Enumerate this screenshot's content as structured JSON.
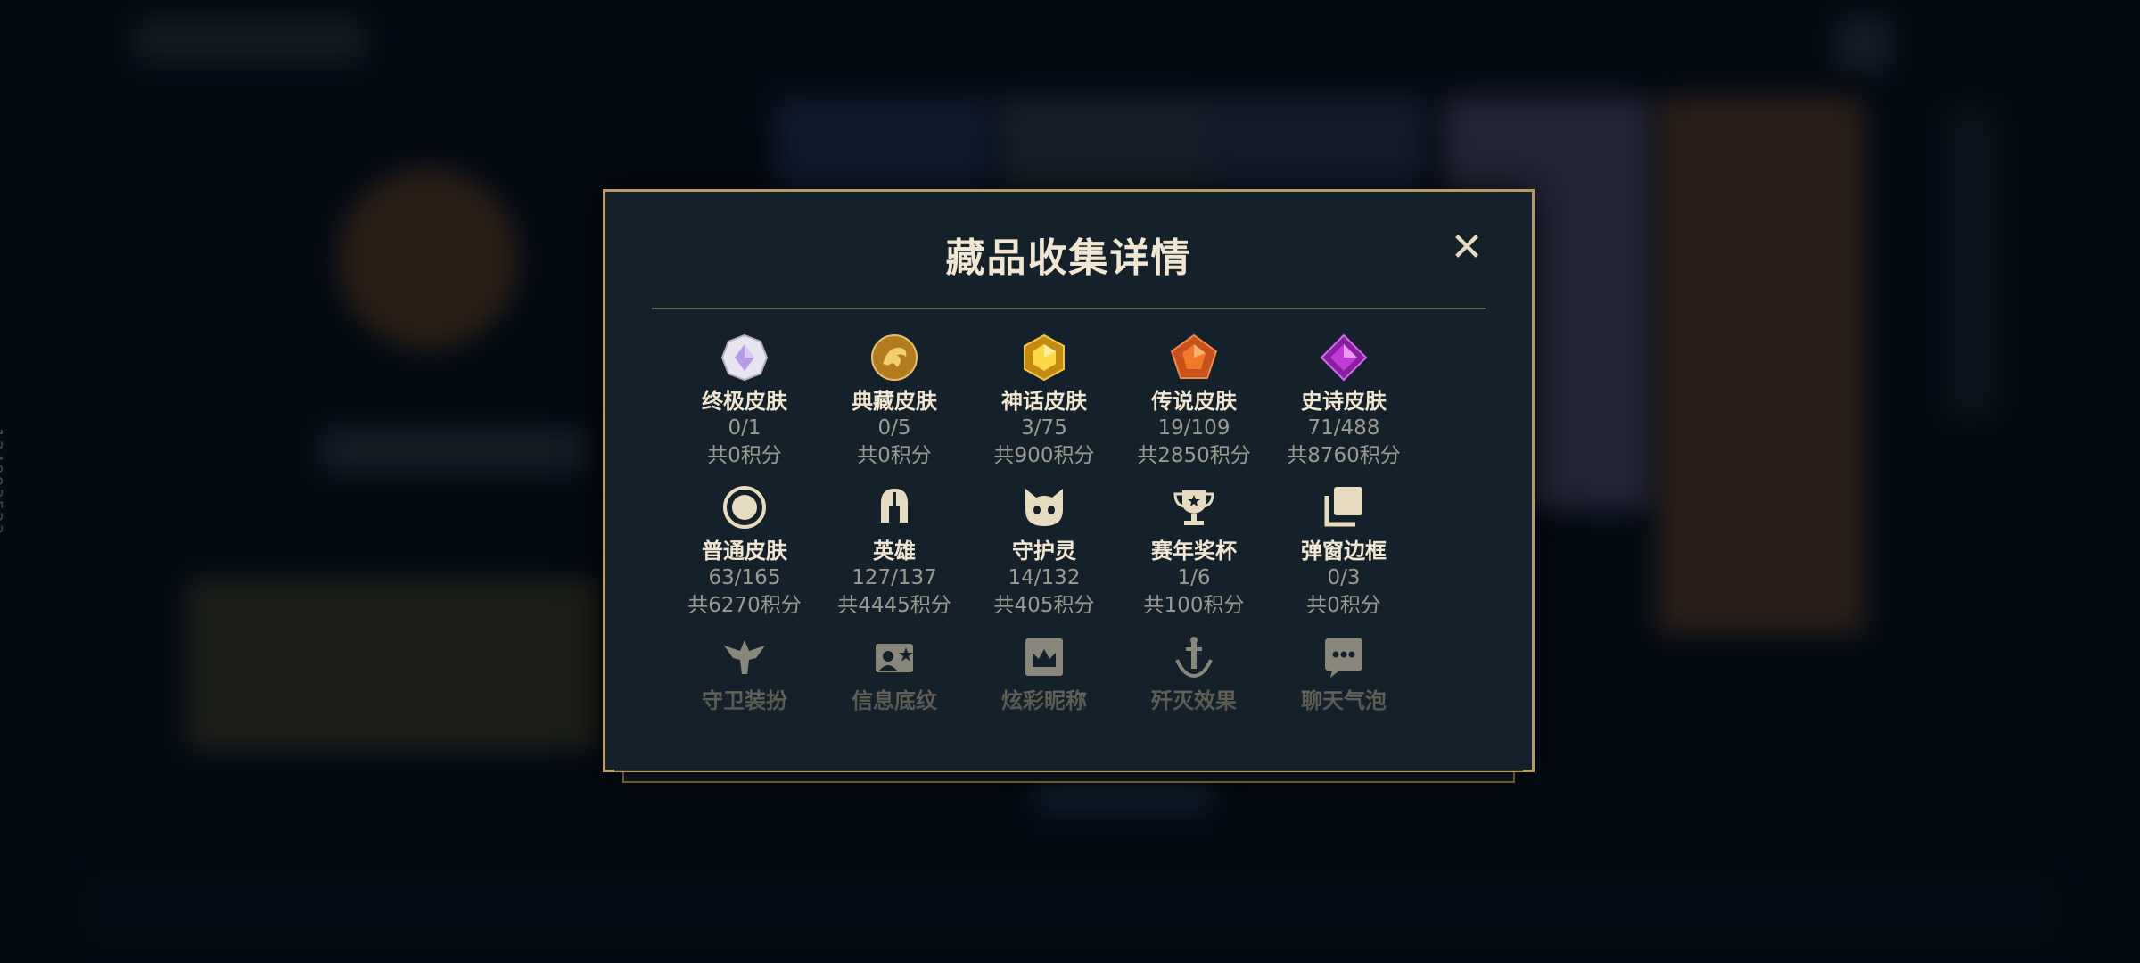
{
  "side_id": "134983523",
  "modal": {
    "title": "藏品收集详情",
    "close_glyph": "✕"
  },
  "items": [
    {
      "icon": "ultimate-skin-icon",
      "label": "终极皮肤",
      "count": "0/1",
      "points": "共0积分"
    },
    {
      "icon": "prestige-skin-icon",
      "label": "典藏皮肤",
      "count": "0/5",
      "points": "共0积分"
    },
    {
      "icon": "mythic-skin-icon",
      "label": "神话皮肤",
      "count": "3/75",
      "points": "共900积分"
    },
    {
      "icon": "legendary-skin-icon",
      "label": "传说皮肤",
      "count": "19/109",
      "points": "共2850积分"
    },
    {
      "icon": "epic-skin-icon",
      "label": "史诗皮肤",
      "count": "71/488",
      "points": "共8760积分"
    },
    {
      "icon": "standard-skin-icon",
      "label": "普通皮肤",
      "count": "63/165",
      "points": "共6270积分"
    },
    {
      "icon": "champion-helmet-icon",
      "label": "英雄",
      "count": "127/137",
      "points": "共4445积分"
    },
    {
      "icon": "ward-spirit-icon",
      "label": "守护灵",
      "count": "14/132",
      "points": "共405积分"
    },
    {
      "icon": "trophy-icon",
      "label": "赛年奖杯",
      "count": "1/6",
      "points": "共100积分"
    },
    {
      "icon": "popup-frame-icon",
      "label": "弹窗边框",
      "count": "0/3",
      "points": "共0积分"
    },
    {
      "icon": "ward-skin-icon",
      "label": "守卫装扮"
    },
    {
      "icon": "info-card-icon",
      "label": "信息底纹"
    },
    {
      "icon": "nickname-icon",
      "label": "炫彩昵称"
    },
    {
      "icon": "finisher-icon",
      "label": "歼灭效果"
    },
    {
      "icon": "chat-bubble-icon",
      "label": "聊天气泡"
    }
  ],
  "colors": {
    "gold_border": "#b89b5e",
    "panel": "#15212a",
    "title": "#f0e6d2",
    "muted": "#9a9a92"
  }
}
